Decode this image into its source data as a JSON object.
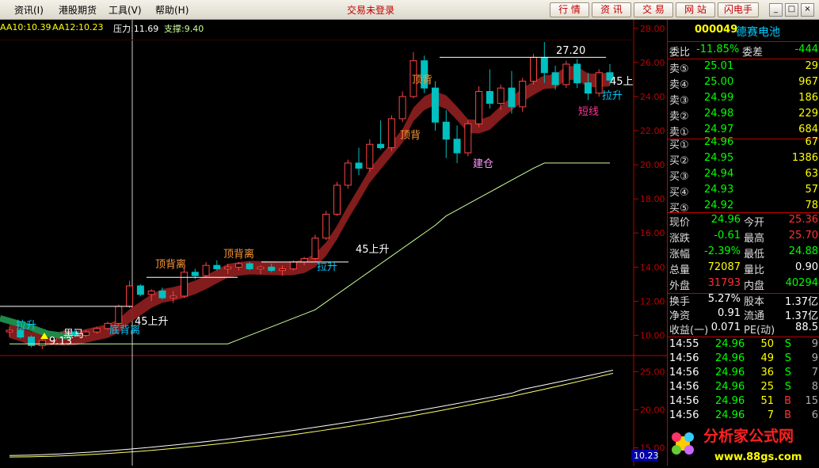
{
  "menu": {
    "items": [
      "资讯(I)",
      "港股期货",
      "工具(V)",
      "帮助(H)"
    ]
  },
  "login_status": "交易未登录",
  "toolbar": {
    "buttons": [
      "行 情",
      "资 讯",
      "交 易",
      "网 站",
      "闪电手"
    ]
  },
  "window": {
    "min": "_",
    "max": "□",
    "close": "×"
  },
  "indicators": {
    "aa10": "AA10:10.39",
    "aa12": "AA12:10.23",
    "pressure": "压力:11.69",
    "support": "支撑:9.40"
  },
  "colors": {
    "up": "#ff4444",
    "down": "#00c0c0",
    "axis": "#c00000",
    "band": "#8a1d1d",
    "support_line": "#ccff99",
    "yellow": "#ffff00",
    "green": "#00ff00",
    "red": "#ff3030"
  },
  "chart_data": {
    "type": "candlestick",
    "ylim": [
      9,
      28.5
    ],
    "y_ticks": [
      "28.00",
      "26.00",
      "24.00",
      "22.00",
      "20.00",
      "18.00",
      "16.00",
      "14.00",
      "12.00",
      "10.00"
    ],
    "sub_ticks": [
      "25.00",
      "20.00",
      "15.00"
    ],
    "sub_value": "10.23",
    "candles": [
      [
        10.2,
        10.5,
        9.9,
        10.3
      ],
      [
        10.3,
        10.4,
        9.8,
        9.9
      ],
      [
        9.9,
        10.0,
        9.3,
        9.4
      ],
      [
        9.4,
        9.8,
        9.2,
        9.7
      ],
      [
        9.7,
        10.1,
        9.6,
        10.0
      ],
      [
        10.0,
        10.3,
        9.9,
        10.2
      ],
      [
        10.2,
        10.4,
        9.9,
        10.0
      ],
      [
        10.0,
        10.3,
        9.9,
        10.2
      ],
      [
        10.2,
        10.5,
        10.1,
        10.4
      ],
      [
        10.4,
        10.8,
        10.3,
        10.7
      ],
      [
        10.7,
        11.8,
        10.6,
        11.7
      ],
      [
        11.7,
        13.2,
        11.6,
        12.9
      ],
      [
        12.9,
        13.0,
        12.3,
        12.4
      ],
      [
        12.4,
        12.7,
        12.0,
        12.6
      ],
      [
        12.6,
        12.8,
        12.1,
        12.2
      ],
      [
        12.2,
        12.6,
        11.9,
        12.3
      ],
      [
        12.3,
        13.9,
        12.2,
        13.7
      ],
      [
        13.7,
        13.9,
        13.3,
        13.5
      ],
      [
        13.5,
        14.3,
        13.4,
        14.1
      ],
      [
        14.1,
        14.4,
        13.8,
        13.9
      ],
      [
        13.9,
        14.2,
        13.6,
        14.0
      ],
      [
        14.0,
        14.3,
        13.8,
        14.2
      ],
      [
        14.2,
        14.3,
        13.8,
        13.9
      ],
      [
        13.9,
        14.1,
        13.6,
        14.0
      ],
      [
        14.0,
        14.2,
        13.7,
        13.8
      ],
      [
        13.8,
        14.1,
        13.5,
        13.9
      ],
      [
        13.9,
        14.4,
        13.8,
        14.3
      ],
      [
        14.3,
        14.6,
        14.1,
        14.5
      ],
      [
        14.5,
        15.9,
        14.4,
        15.7
      ],
      [
        15.7,
        17.3,
        15.6,
        17.1
      ],
      [
        17.1,
        19.0,
        17.0,
        18.8
      ],
      [
        18.8,
        20.3,
        18.6,
        20.1
      ],
      [
        20.1,
        21.0,
        19.4,
        19.8
      ],
      [
        19.8,
        21.5,
        19.6,
        21.2
      ],
      [
        21.2,
        22.6,
        20.9,
        21.0
      ],
      [
        21.0,
        22.9,
        20.8,
        22.7
      ],
      [
        22.7,
        24.3,
        22.5,
        24.0
      ],
      [
        24.0,
        26.6,
        23.9,
        26.1
      ],
      [
        26.1,
        26.4,
        24.2,
        24.5
      ],
      [
        24.5,
        24.9,
        22.0,
        22.5
      ],
      [
        22.5,
        23.2,
        20.4,
        21.5
      ],
      [
        21.5,
        22.3,
        20.1,
        20.7
      ],
      [
        20.7,
        22.6,
        20.5,
        22.4
      ],
      [
        22.4,
        24.6,
        22.2,
        24.3
      ],
      [
        24.3,
        25.6,
        23.3,
        23.6
      ],
      [
        23.6,
        24.7,
        23.2,
        24.5
      ],
      [
        24.5,
        25.5,
        23.0,
        23.4
      ],
      [
        23.4,
        25.1,
        23.1,
        24.9
      ],
      [
        24.9,
        26.5,
        24.7,
        26.3
      ],
      [
        26.3,
        27.2,
        24.8,
        25.4
      ],
      [
        25.4,
        25.8,
        24.4,
        24.7
      ],
      [
        24.7,
        26.1,
        24.5,
        25.9
      ],
      [
        25.9,
        26.2,
        24.5,
        24.8
      ],
      [
        24.8,
        25.4,
        23.8,
        24.2
      ],
      [
        24.2,
        25.6,
        24.0,
        25.4
      ],
      [
        25.4,
        25.9,
        24.7,
        24.96
      ]
    ],
    "labels": [
      "顶背离",
      "顶背离",
      "顶背",
      "顶背",
      "45上升",
      "45上升",
      "45上",
      "拉升",
      "拉升",
      "拉升",
      "短线",
      "建仓",
      "黑马",
      "底背离",
      "9.13",
      "27.20"
    ]
  },
  "panel": {
    "code": "000049",
    "name": "德赛电池",
    "weibi_label": "委比",
    "weibi": "-11.85%",
    "weicha_label": "委差",
    "weicha": "-444",
    "asks": [
      {
        "label": "卖⑤",
        "price": "25.01",
        "vol": "29"
      },
      {
        "label": "卖④",
        "price": "25.00",
        "vol": "967"
      },
      {
        "label": "卖③",
        "price": "24.99",
        "vol": "186"
      },
      {
        "label": "卖②",
        "price": "24.98",
        "vol": "229"
      },
      {
        "label": "卖①",
        "price": "24.97",
        "vol": "684"
      }
    ],
    "bids": [
      {
        "label": "买①",
        "price": "24.96",
        "vol": "67"
      },
      {
        "label": "买②",
        "price": "24.95",
        "vol": "1386"
      },
      {
        "label": "买③",
        "price": "24.94",
        "vol": "63"
      },
      {
        "label": "买④",
        "price": "24.93",
        "vol": "57"
      },
      {
        "label": "买⑤",
        "price": "24.92",
        "vol": "78"
      }
    ],
    "stats": [
      {
        "l1": "现价",
        "v1": "24.96",
        "l2": "今开",
        "v2": "25.36"
      },
      {
        "l1": "涨跌",
        "v1": "-0.61",
        "l2": "最高",
        "v2": "25.70"
      },
      {
        "l1": "涨幅",
        "v1": "-2.39%",
        "l2": "最低",
        "v2": "24.88"
      },
      {
        "l1": "总量",
        "v1": "72087",
        "l2": "量比",
        "v2": "0.90"
      },
      {
        "l1": "外盘",
        "v1": "31793",
        "l2": "内盘",
        "v2": "40294"
      }
    ],
    "stats2": [
      {
        "l1": "换手",
        "v1": "5.27%",
        "l2": "股本",
        "v2": "1.37亿"
      },
      {
        "l1": "净资",
        "v1": "0.91",
        "l2": "流通",
        "v2": "1.37亿"
      },
      {
        "l1": "收益(一)",
        "v1": "0.071",
        "l2": "PE(动)",
        "v2": "88.5"
      }
    ],
    "ticks": [
      {
        "time": "14:55",
        "price": "24.96",
        "vol": "50",
        "side": "S",
        "n": "9"
      },
      {
        "time": "14:56",
        "price": "24.96",
        "vol": "49",
        "side": "S",
        "n": "9"
      },
      {
        "time": "14:56",
        "price": "24.96",
        "vol": "36",
        "side": "S",
        "n": "7"
      },
      {
        "time": "14:56",
        "price": "24.96",
        "vol": "25",
        "side": "S",
        "n": "8"
      },
      {
        "time": "14:56",
        "price": "24.96",
        "vol": "51",
        "side": "B",
        "n": "15"
      },
      {
        "time": "14:56",
        "price": "24.96",
        "vol": "7",
        "side": "B",
        "n": "6"
      }
    ]
  },
  "logo": {
    "main": "分析家公式网",
    "url": "www.88gs.com"
  }
}
